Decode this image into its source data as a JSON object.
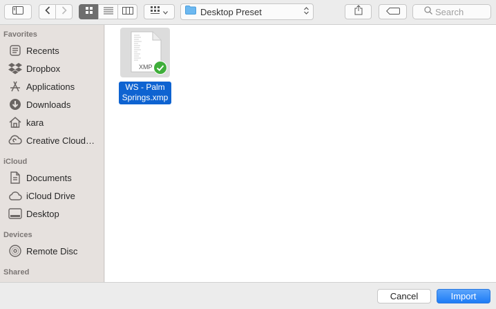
{
  "toolbar": {
    "location": "Desktop Preset",
    "search_placeholder": "Search"
  },
  "sidebar": {
    "favorites_heading": "Favorites",
    "favorites": [
      {
        "label": "Recents",
        "icon": "clock-icon"
      },
      {
        "label": "Dropbox",
        "icon": "dropbox-icon"
      },
      {
        "label": "Applications",
        "icon": "applications-icon"
      },
      {
        "label": "Downloads",
        "icon": "downloads-icon"
      },
      {
        "label": "kara",
        "icon": "home-icon"
      },
      {
        "label": "Creative Cloud…",
        "icon": "creative-cloud-icon"
      }
    ],
    "icloud_heading": "iCloud",
    "icloud": [
      {
        "label": "Documents",
        "icon": "documents-icon"
      },
      {
        "label": "iCloud Drive",
        "icon": "icloud-icon"
      },
      {
        "label": "Desktop",
        "icon": "desktop-icon"
      }
    ],
    "devices_heading": "Devices",
    "devices": [
      {
        "label": "Remote Disc",
        "icon": "disc-icon"
      }
    ],
    "shared_heading": "Shared"
  },
  "files": [
    {
      "name_line1": "WS - Palm",
      "name_line2": "Springs.xmp",
      "ext": "XMP",
      "selected": true
    }
  ],
  "buttons": {
    "cancel": "Cancel",
    "import": "Import"
  },
  "colors": {
    "selection": "#0e63d1",
    "primary_button": "#1d7cf6",
    "sidebar_bg": "#e6e1de",
    "check_badge": "#3fae3a"
  }
}
